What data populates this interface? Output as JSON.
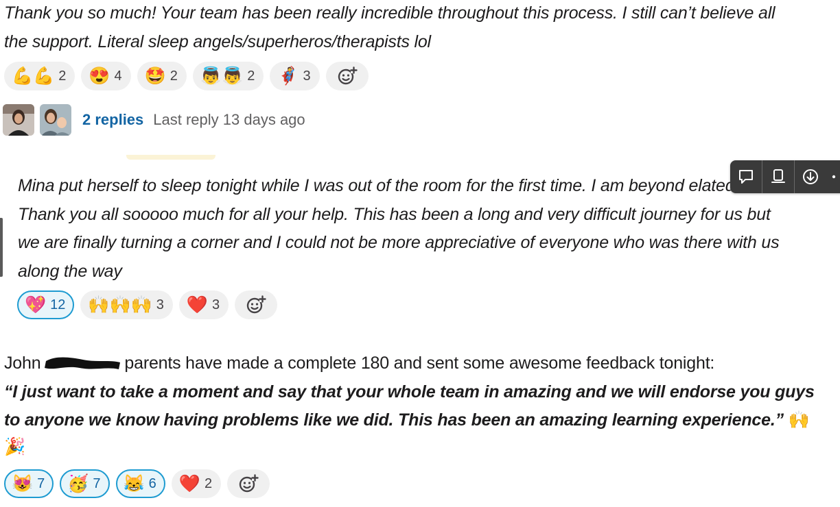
{
  "messages": [
    {
      "lines": [
        "Thank you so much! Your team has been really incredible throughout this process. I still can’t believe all",
        "the support. Literal sleep angels/superheros/therapists lol"
      ],
      "reactions": [
        {
          "emoji": "💪💪",
          "count": "2",
          "active": false
        },
        {
          "emoji": "😍",
          "count": "4",
          "active": false
        },
        {
          "emoji": "🤩",
          "count": "2",
          "active": false
        },
        {
          "emoji": "👼👼",
          "count": "2",
          "active": false
        },
        {
          "emoji": "🦸",
          "count": "3",
          "active": false
        }
      ],
      "thread": {
        "replies": "2 replies",
        "last_reply": "Last reply 13 days ago"
      }
    },
    {
      "lines": [
        "Mina put herself to sleep tonight while I was out of the room for the first time. I am beyond elated.",
        "Thank you all sooooo much for all your help. This has been a long and very difficult journey for us but",
        "we are finally turning a corner and I could not be more appreciative of everyone who was there with us",
        "along the way"
      ],
      "reactions": [
        {
          "emoji": "💖",
          "count": "12",
          "active": true
        },
        {
          "emoji": "🙌🙌🙌",
          "count": "3",
          "active": false
        },
        {
          "emoji": "❤️",
          "count": "3",
          "active": false
        }
      ]
    },
    {
      "line1_prefix": "John",
      "line1_suffix": "parents have made a complete 180 and sent some awesome feedback tonight:",
      "quote_line1": "“I just want to take a moment and say that your whole team in amazing and we will endorse you guys",
      "quote_line2": "to anyone we know having problems like we did. This has been an amazing learning experience.”",
      "trailing_emoji_1": "🙌",
      "trailing_emoji_2": "🎉",
      "reactions": [
        {
          "emoji": "😻",
          "count": "7",
          "active": true
        },
        {
          "emoji": "🥳",
          "count": "7",
          "active": true
        },
        {
          "emoji": "😹",
          "count": "6",
          "active": true
        },
        {
          "emoji": "❤️",
          "count": "2",
          "active": false
        }
      ]
    }
  ],
  "icons": {
    "add_reaction": "add-reaction-icon",
    "toolbar": [
      "comment-icon",
      "bookmark-icon",
      "download-icon",
      "more-icon"
    ]
  },
  "colors": {
    "link": "#1264a3",
    "active_border": "#1d9bd1",
    "active_bg": "#e8f5fa",
    "pill_bg": "#f0f0f0",
    "toolbar_bg": "#3a3a3a"
  }
}
